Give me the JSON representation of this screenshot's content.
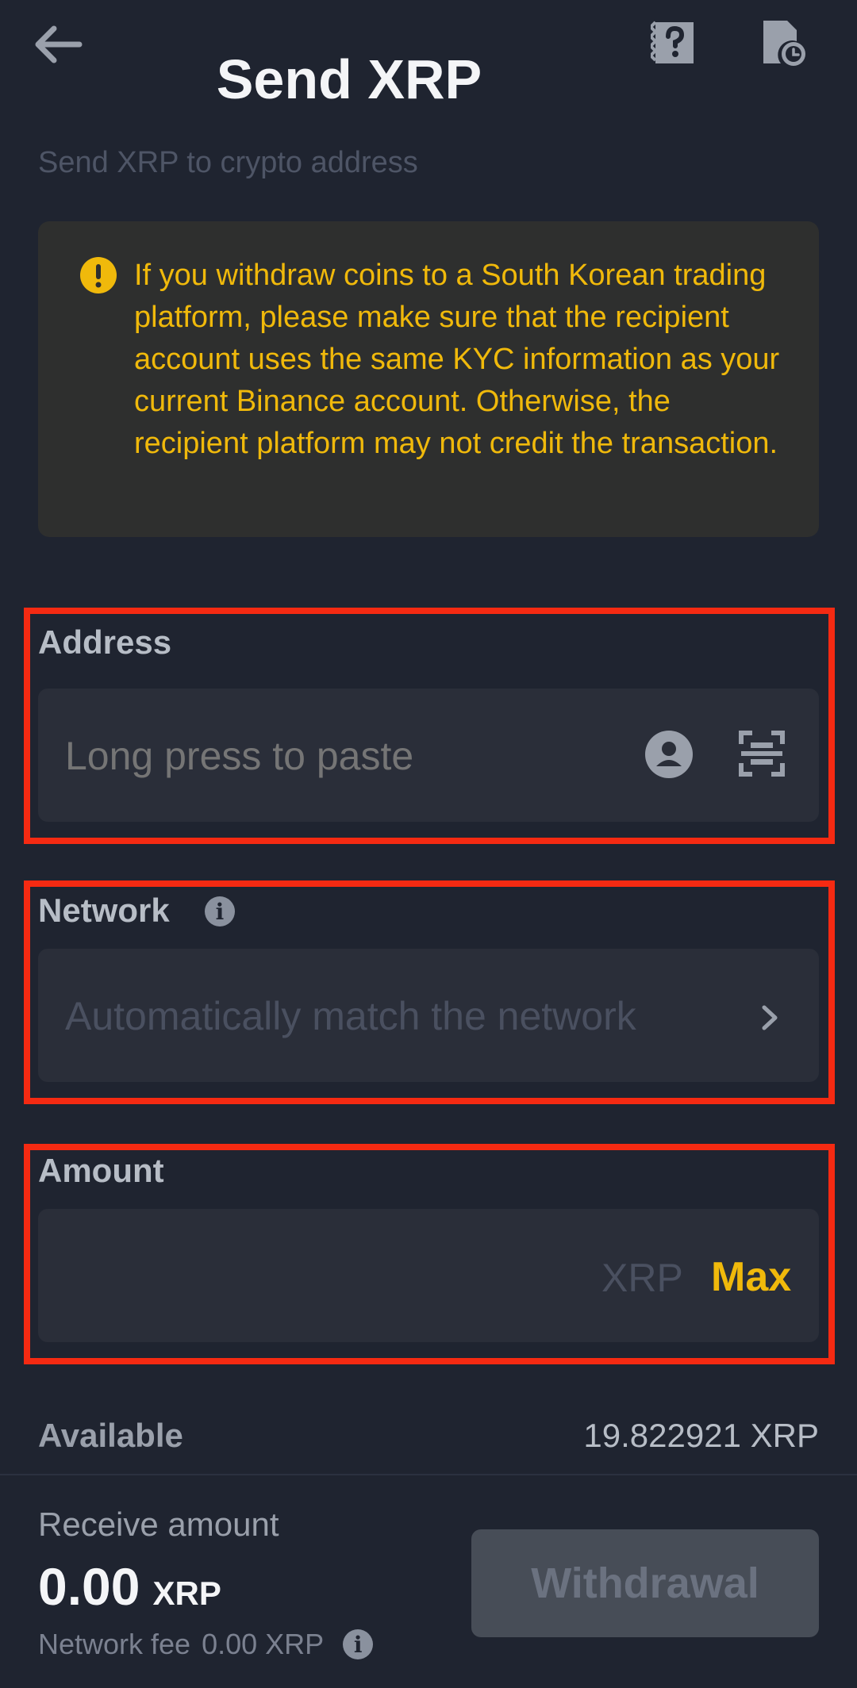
{
  "header": {
    "title": "Send XRP",
    "subtitle": "Send XRP to crypto address",
    "back_icon": "arrow-left-icon",
    "help_icon": "help-document-icon",
    "history_icon": "history-document-icon"
  },
  "warning": {
    "icon": "exclamation-icon",
    "text": "If you withdraw coins to a South Korean trading platform, please make sure that the recipient account uses the same KYC information as your current Binance account. Otherwise, the recipient platform may not credit the transaction."
  },
  "address": {
    "label": "Address",
    "placeholder": "Long press to paste",
    "value": "",
    "contact_icon": "address-book-icon",
    "scan_icon": "scan-qr-icon"
  },
  "network": {
    "label": "Network",
    "info_icon": "info-icon",
    "placeholder": "Automatically match the network",
    "chevron_icon": "chevron-right-icon"
  },
  "amount": {
    "label": "Amount",
    "value": "",
    "currency": "XRP",
    "max_label": "Max"
  },
  "available": {
    "label": "Available",
    "value": "19.822921 XRP"
  },
  "receive": {
    "label": "Receive amount",
    "amount": "0.00",
    "currency": "XRP",
    "fee_label": "Network fee",
    "fee_value": "0.00 XRP",
    "info_icon": "info-icon"
  },
  "withdraw_button": {
    "label": "Withdrawal"
  },
  "colors": {
    "background": "#1f2430",
    "field_bg": "#2a2e39",
    "accent_yellow": "#f0b90b",
    "highlight_frame": "#f52a12",
    "button_disabled": "#474d57"
  }
}
